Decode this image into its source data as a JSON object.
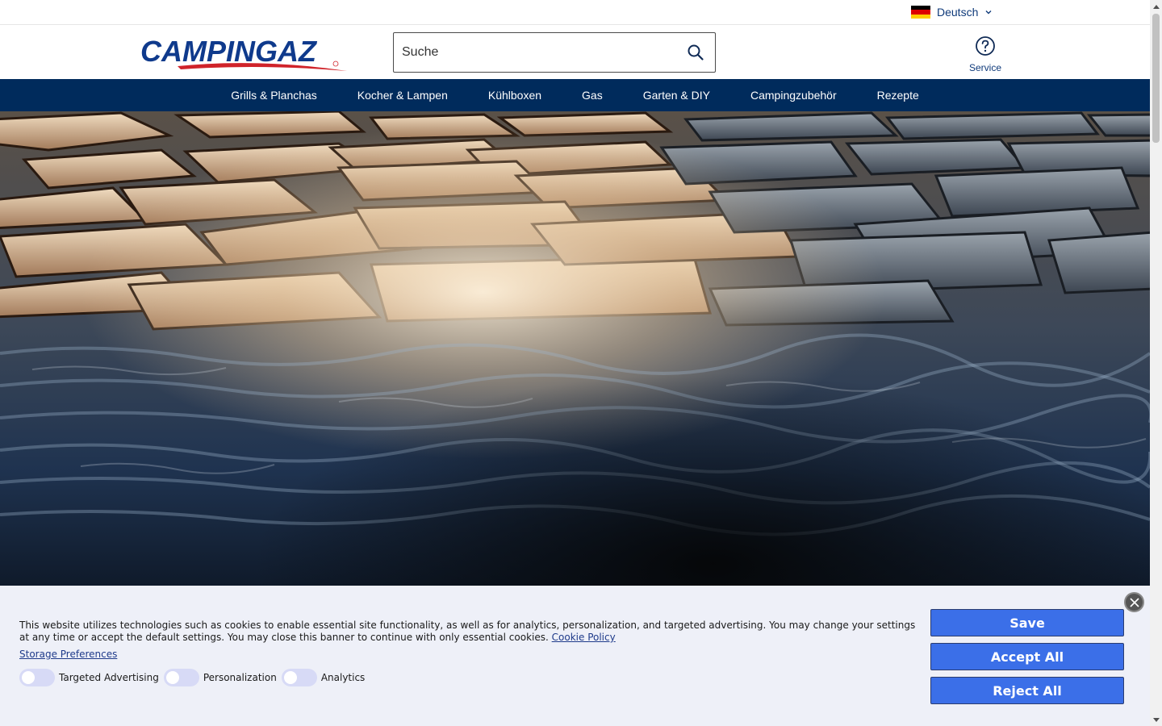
{
  "language": {
    "label": "Deutsch",
    "flag_colors": [
      "#000000",
      "#dd0000",
      "#ffce00"
    ]
  },
  "brand": {
    "name": "CAMPINGAZ",
    "color": "#0f3a8c",
    "swoosh_color": "#d0232a"
  },
  "search": {
    "placeholder": "Suche"
  },
  "service": {
    "label": "Service"
  },
  "nav": {
    "items": [
      {
        "label": "Grills & Planchas"
      },
      {
        "label": "Kocher & Lampen"
      },
      {
        "label": "Kühlboxen"
      },
      {
        "label": "Gas"
      },
      {
        "label": "Garten & DIY"
      },
      {
        "label": "Campingzubehör"
      },
      {
        "label": "Rezepte"
      }
    ]
  },
  "cookie": {
    "text": "This website utilizes technologies such as cookies to enable essential site functionality, as well as for analytics, personalization, and targeted advertising. You may change your settings at any time or accept the default settings. You may close this banner to continue with only essential cookies.",
    "policy_link": "Cookie Policy",
    "preferences_link": "Storage Preferences",
    "toggles": [
      {
        "label": "Targeted Advertising",
        "on": false
      },
      {
        "label": "Personalization",
        "on": false
      },
      {
        "label": "Analytics",
        "on": false
      }
    ],
    "buttons": {
      "save": "Save",
      "accept": "Accept All",
      "reject": "Reject All"
    }
  },
  "colors": {
    "nav_bg": "#002b5c",
    "button_bg": "#3b6fe8",
    "banner_bg": "#eef0f8"
  }
}
